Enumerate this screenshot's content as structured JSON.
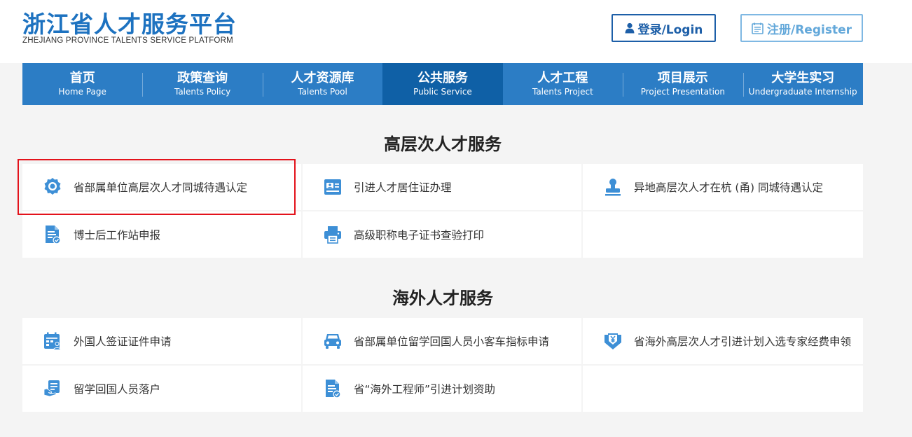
{
  "header": {
    "logo_cn": "浙江省人才服务平台",
    "logo_en": "ZHEJIANG PROVINCE TALENTS SERVICE PLATFORM",
    "login_label": "登录/Login",
    "register_label": "注册/Register"
  },
  "nav": {
    "items": [
      {
        "cn": "首页",
        "en": "Home Page"
      },
      {
        "cn": "政策查询",
        "en": "Talents Policy"
      },
      {
        "cn": "人才资源库",
        "en": "Talents Pool"
      },
      {
        "cn": "公共服务",
        "en": "Public Service"
      },
      {
        "cn": "人才工程",
        "en": "Talents Project"
      },
      {
        "cn": "项目展示",
        "en": "Project Presentation"
      },
      {
        "cn": "大学生实习",
        "en": "Undergraduate Internship"
      }
    ],
    "active_index": 3
  },
  "sections": [
    {
      "title": "高层次人才服务",
      "items": [
        {
          "label": "省部属单位高层次人才同城待遇认定",
          "icon": "badge-icon"
        },
        {
          "label": "引进人才居住证办理",
          "icon": "id-card-icon"
        },
        {
          "label": "异地高层次人才在杭 (甬) 同城待遇认定",
          "icon": "stamp-icon"
        },
        {
          "label": "博士后工作站申报",
          "icon": "document-check-icon"
        },
        {
          "label": "高级职称电子证书查验打印",
          "icon": "printer-icon"
        },
        {
          "label": "",
          "icon": ""
        }
      ]
    },
    {
      "title": "海外人才服务",
      "items": [
        {
          "label": "外国人签证证件申请",
          "icon": "calendar-person-icon"
        },
        {
          "label": "省部属单位留学回国人员小客车指标申请",
          "icon": "car-icon"
        },
        {
          "label": "省海外高层次人才引进计划入选专家经费申领",
          "icon": "money-shield-icon"
        },
        {
          "label": "留学回国人员落户",
          "icon": "hand-document-icon"
        },
        {
          "label": "省“海外工程师”引进计划资助",
          "icon": "document-check-icon"
        },
        {
          "label": "",
          "icon": ""
        }
      ]
    }
  ],
  "colors": {
    "brand": "#1d72c0",
    "nav_bg": "#2c7dc5",
    "nav_active": "#0f60a6",
    "icon": "#3d8fd6",
    "highlight": "#e3121b"
  }
}
